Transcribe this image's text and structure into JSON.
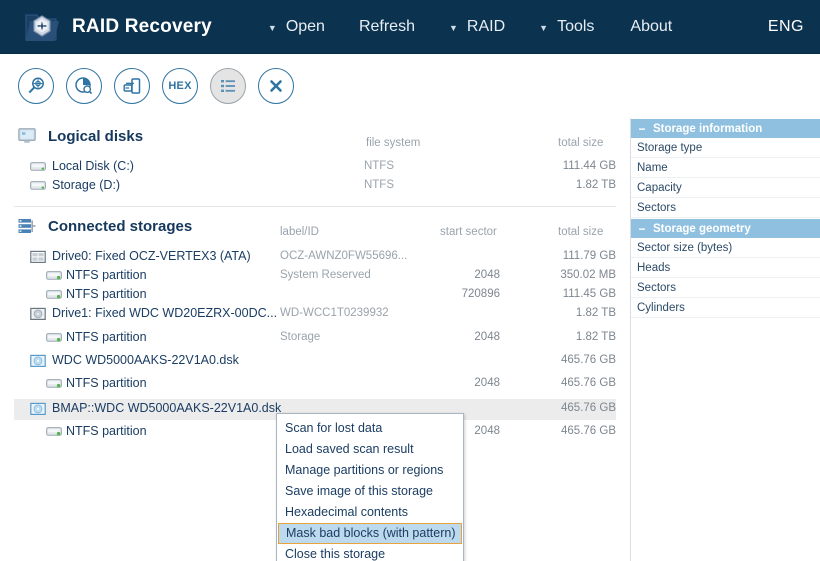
{
  "header": {
    "app_title": "RAID Recovery",
    "logo_icon": "raid-folder-logo-icon",
    "menu": [
      {
        "label": "Open",
        "caret": "▼",
        "has_caret": true
      },
      {
        "label": "Refresh",
        "caret": "",
        "has_caret": false
      },
      {
        "label": "RAID",
        "caret": "▼",
        "has_caret": true
      },
      {
        "label": "Tools",
        "caret": "▼",
        "has_caret": true
      },
      {
        "label": "About",
        "caret": "",
        "has_caret": false
      }
    ],
    "language": "ENG",
    "bg_color": "#0b3350"
  },
  "toolbar": {
    "buttons": [
      {
        "name": "scan-for-lost-data-icon",
        "kind": "magnifier",
        "label": "",
        "active": false
      },
      {
        "name": "disk-scan-icon",
        "kind": "pie-search",
        "label": "",
        "active": false
      },
      {
        "name": "save-image-icon",
        "kind": "export-disk",
        "label": "",
        "active": false
      },
      {
        "name": "hexadecimal-contents-icon",
        "kind": "hex",
        "label": "HEX",
        "active": false
      },
      {
        "name": "list-view-icon",
        "kind": "list",
        "label": "",
        "active": true
      },
      {
        "name": "close-storage-icon",
        "kind": "close",
        "label": "",
        "active": false
      }
    ]
  },
  "logical_disks": {
    "title": "Logical disks",
    "icon": "monitor-icon",
    "columns": {
      "file_system": "file system",
      "total_size": "total size"
    },
    "rows": [
      {
        "icon": "drive-icon",
        "name": "Local Disk (C:)",
        "file_system": "NTFS",
        "total_size": "111.44 GB"
      },
      {
        "icon": "drive-icon",
        "name": "Storage (D:)",
        "file_system": "NTFS",
        "total_size": "1.82 TB"
      }
    ]
  },
  "connected_storages": {
    "title": "Connected storages",
    "icon": "storage-stack-icon",
    "columns": {
      "label_id": "label/ID",
      "start_sector": "start sector",
      "total_size": "total size"
    },
    "rows": [
      {
        "icon": "ssd-icon",
        "indent": 0,
        "name": "Drive0: Fixed OCZ-VERTEX3 (ATA)",
        "label_id": "OCZ-AWNZ0FW55696...",
        "start_sector": "",
        "total_size": "111.79 GB",
        "selected": false
      },
      {
        "icon": "partition-icon",
        "indent": 1,
        "name": "NTFS partition",
        "label_id": "System Reserved",
        "start_sector": "2048",
        "total_size": "350.02 MB",
        "selected": false
      },
      {
        "icon": "partition-icon",
        "indent": 1,
        "name": "NTFS partition",
        "label_id": "",
        "start_sector": "720896",
        "total_size": "111.45 GB",
        "selected": false
      },
      {
        "icon": "hdd-icon",
        "indent": 0,
        "name": "Drive1: Fixed WDC WD20EZRX-00DC...",
        "label_id": "WD-WCC1T0239932",
        "start_sector": "",
        "total_size": "1.82 TB",
        "selected": false
      },
      {
        "icon": "partition-icon",
        "indent": 1,
        "name": "NTFS partition",
        "label_id": "Storage",
        "start_sector": "2048",
        "total_size": "1.82 TB",
        "selected": false
      },
      {
        "icon": "image-disk-icon",
        "indent": 0,
        "name": "WDC WD5000AAKS-22V1A0.dsk",
        "label_id": "",
        "start_sector": "",
        "total_size": "465.76 GB",
        "selected": false
      },
      {
        "icon": "partition-icon",
        "indent": 1,
        "name": "NTFS partition",
        "label_id": "",
        "start_sector": "2048",
        "total_size": "465.76 GB",
        "selected": false
      },
      {
        "icon": "image-disk-icon",
        "indent": 0,
        "name": "BMAP::WDC WD5000AAKS-22V1A0.dsk",
        "label_id": "",
        "start_sector": "",
        "total_size": "465.76 GB",
        "selected": true
      },
      {
        "icon": "partition-icon",
        "indent": 1,
        "name": "NTFS partition",
        "label_id": "",
        "start_sector": "2048",
        "total_size": "465.76 GB",
        "selected": false
      }
    ]
  },
  "context_menu": {
    "items": [
      {
        "label": "Scan for lost data",
        "highlighted": false
      },
      {
        "label": "Load saved scan result",
        "highlighted": false
      },
      {
        "label": "Manage partitions or regions",
        "highlighted": false
      },
      {
        "label": "Save image of this storage",
        "highlighted": false
      },
      {
        "label": "Hexadecimal contents",
        "highlighted": false
      },
      {
        "label": "Mask bad blocks (with pattern)",
        "highlighted": true
      },
      {
        "label": "Close this storage",
        "highlighted": false
      }
    ],
    "highlight_bg": "#bcd9ee",
    "highlight_border": "#e8a33d"
  },
  "right_panel": {
    "header_bg": "#8fc0e0",
    "collapse_glyph": "−",
    "sections": [
      {
        "title": "Storage information",
        "rows": [
          {
            "label": "Storage type",
            "value": ""
          },
          {
            "label": "Name",
            "value": ""
          },
          {
            "label": "Capacity",
            "value": ""
          },
          {
            "label": "Sectors",
            "value": ""
          }
        ]
      },
      {
        "title": "Storage geometry",
        "rows": [
          {
            "label": "Sector size (bytes)",
            "value": ""
          },
          {
            "label": "Heads",
            "value": ""
          },
          {
            "label": "Sectors",
            "value": ""
          },
          {
            "label": "Cylinders",
            "value": ""
          }
        ]
      }
    ]
  }
}
